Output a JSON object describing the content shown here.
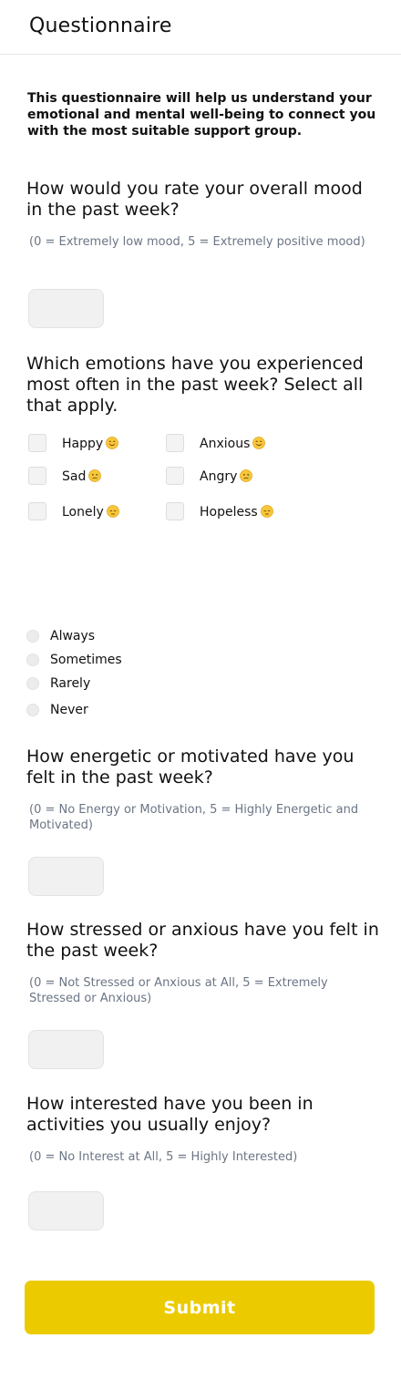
{
  "header": {
    "title": "Questionnaire"
  },
  "intro": "This questionnaire will help us understand your emotional and mental well-being to connect you with the most suitable support group.",
  "q_mood": {
    "question": "How would you rate your overall mood in the past week?",
    "hint": "(0 = Extremely low mood, 5 = Extremely positive mood)",
    "value": ""
  },
  "q_emotions": {
    "question": "Which emotions have you experienced most often in the past week? Select all that apply.",
    "options": [
      {
        "label": "Happy",
        "icon": "smiling-face-icon"
      },
      {
        "label": "Anxious",
        "icon": "smiling-face-icon"
      },
      {
        "label": "Sad",
        "icon": "crying-face-icon"
      },
      {
        "label": "Angry",
        "icon": "crying-face-icon"
      },
      {
        "label": "Lonely",
        "icon": "pensive-face-icon"
      },
      {
        "label": "Hopeless",
        "icon": "pensive-face-icon"
      }
    ]
  },
  "q_frequency": {
    "options": [
      "Always",
      "Sometimes",
      "Rarely",
      "Never"
    ]
  },
  "q_energy": {
    "question": "How energetic or motivated have you felt in the past week?",
    "hint": "(0 = No Energy or Motivation, 5 = Highly Energetic and Motivated)",
    "value": ""
  },
  "q_stress": {
    "question": "How stressed or anxious have you felt in the past week?",
    "hint": "(0 = Not Stressed or Anxious at All, 5 = Extremely Stressed or Anxious)",
    "value": ""
  },
  "q_interest": {
    "question": "How interested have you been in activities you usually enjoy?",
    "hint": "(0 = No Interest at All, 5 = Highly Interested)",
    "value": ""
  },
  "submit_label": "Submit",
  "colors": {
    "accent": "#ebcb00",
    "hint": "#6b7585",
    "field_bg": "#f1f1f1"
  }
}
